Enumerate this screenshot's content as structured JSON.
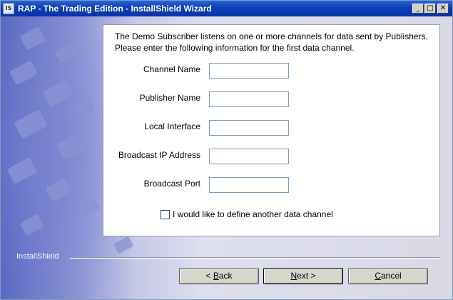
{
  "window": {
    "title": "RAP - The Trading Edition - InstallShield Wizard",
    "icon": "installshield-icon",
    "icon_text": "IS",
    "minimize_glyph": "_",
    "maximize_glyph": "□",
    "close_glyph": "✕"
  },
  "intro_text": "The Demo Subscriber listens on one or more channels for data sent by Publishers.  Please enter the following information for the first data channel.",
  "fields": [
    {
      "label": "Channel Name",
      "value": ""
    },
    {
      "label": "Publisher Name",
      "value": ""
    },
    {
      "label": "Local Interface",
      "value": ""
    },
    {
      "label": "Broadcast IP Address",
      "value": ""
    },
    {
      "label": "Broadcast Port",
      "value": ""
    }
  ],
  "checkbox": {
    "label": "I would like to define another data channel",
    "checked": false
  },
  "brand": "InstallShield",
  "buttons": {
    "back": {
      "prefix": "< ",
      "mnemonic": "B",
      "rest": "ack"
    },
    "next": {
      "mnemonic": "N",
      "rest": "ext >"
    },
    "cancel": {
      "label": "Cancel",
      "mnemonic": "C",
      "rest": "ancel"
    }
  }
}
